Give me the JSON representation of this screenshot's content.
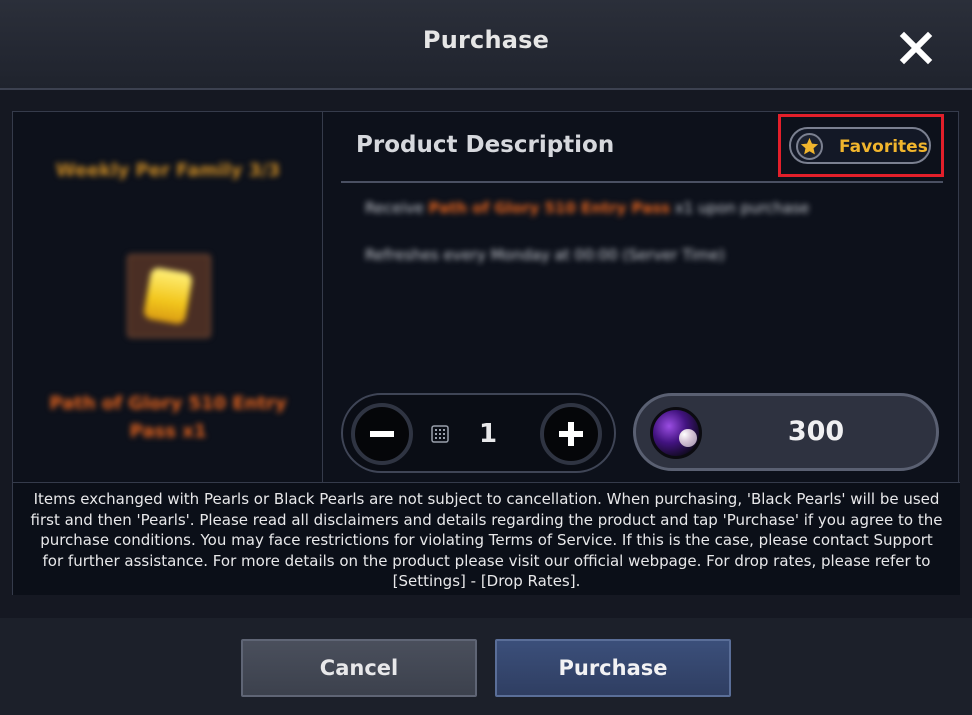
{
  "header": {
    "title": "Purchase"
  },
  "item": {
    "limit": "Weekly Per Family 3/3",
    "name": "Path of Glory 510 Entry Pass x1"
  },
  "description": {
    "title": "Product Description",
    "favorites_label": "Favorites",
    "line1_prefix": "Receive ",
    "line1_highlight": "Path of Glory 510 Entry Pass",
    "line1_suffix": " x1 upon purchase",
    "line2": "Refreshes every Monday at 00:00 (Server Time)"
  },
  "quantity": {
    "value": "1"
  },
  "price": {
    "amount": "300",
    "currency_icon": "pearl-icon"
  },
  "disclaimer": "Items exchanged with Pearls or Black Pearls are not subject to cancellation. When purchasing, 'Black Pearls' will be used first and then 'Pearls'. Please read all disclaimers and details regarding the product and tap 'Purchase' if you agree to the purchase conditions. You may face restrictions for violating Terms of Service. If this is the case, please contact Support for further assistance. For more details on the product please visit our official webpage. For drop rates, please refer to [Settings] - [Drop Rates].",
  "footer": {
    "cancel_label": "Cancel",
    "purchase_label": "Purchase"
  },
  "colors": {
    "highlight": "#e21f2a",
    "favorite_text": "#f1b52d",
    "item_name": "#e1631f",
    "limit_text": "#c98a25"
  }
}
